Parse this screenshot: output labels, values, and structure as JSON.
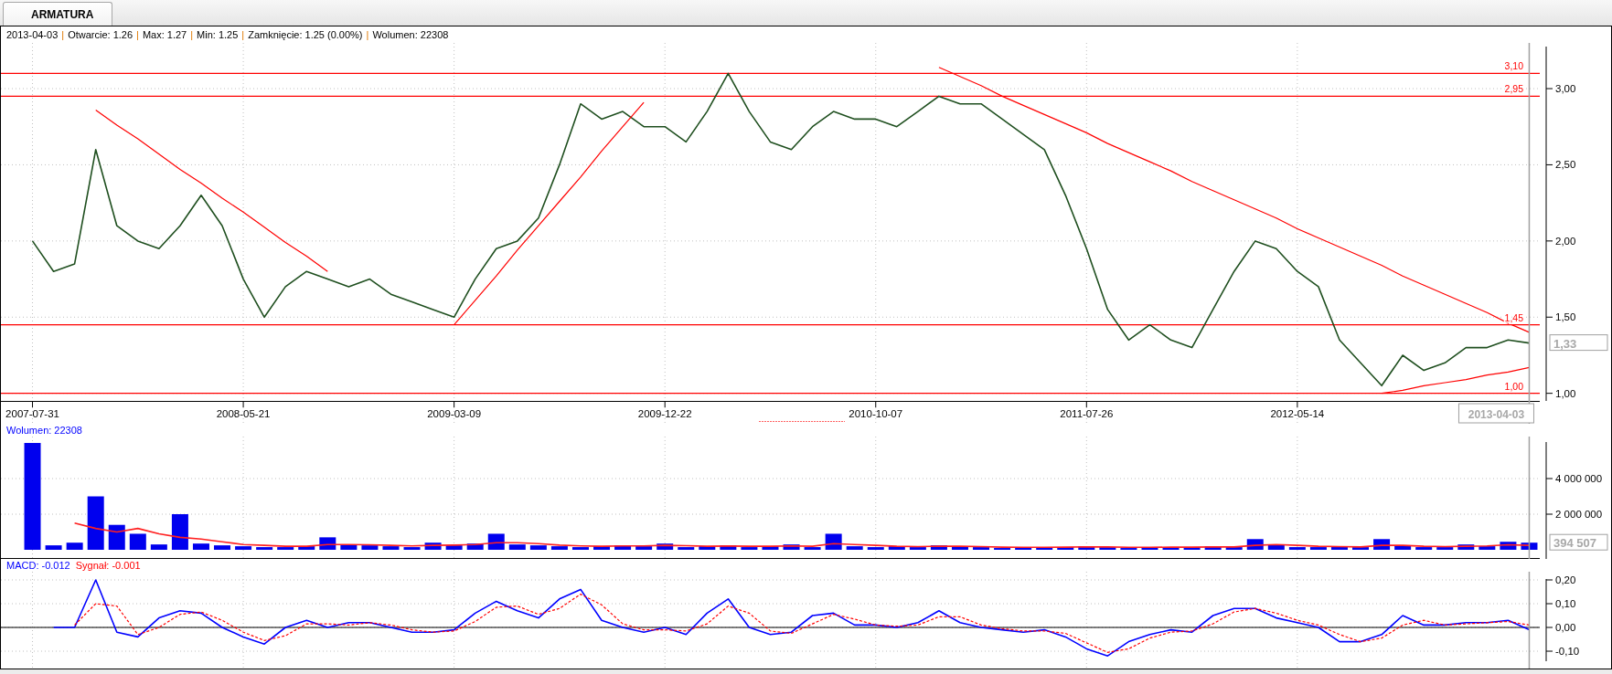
{
  "tabs": [
    {
      "label": "ARMATURA",
      "selected": true
    }
  ],
  "header": [
    {
      "kind": "field",
      "text": "2013-04-03"
    },
    {
      "kind": "separator",
      "text": "|"
    },
    {
      "kind": "field",
      "text": "Otwarcie: 1.26"
    },
    {
      "kind": "separator",
      "text": "|"
    },
    {
      "kind": "field",
      "text": "Max: 1.27"
    },
    {
      "kind": "separator",
      "text": "|"
    },
    {
      "kind": "field",
      "text": "Min: 1.25"
    },
    {
      "kind": "separator",
      "text": "|"
    },
    {
      "kind": "field",
      "text": "Zamknięcie: 1.25 (0.00%)"
    },
    {
      "kind": "separator",
      "text": "|"
    },
    {
      "kind": "field",
      "text": "Wolumen: 22308"
    }
  ],
  "price_panel": {
    "chart_data": {
      "type": "line",
      "grid": true,
      "categories": [
        "2007-07-31",
        null,
        null,
        null,
        null,
        null,
        null,
        null,
        null,
        null,
        "2008-05-21",
        null,
        null,
        null,
        null,
        null,
        null,
        null,
        null,
        null,
        "2009-03-09",
        null,
        null,
        null,
        null,
        null,
        null,
        null,
        null,
        null,
        "2009-12-22",
        null,
        null,
        null,
        null,
        null,
        null,
        null,
        null,
        null,
        "2010-10-07",
        null,
        null,
        null,
        null,
        null,
        null,
        null,
        null,
        null,
        "2011-07-26",
        null,
        null,
        null,
        null,
        null,
        null,
        null,
        null,
        null,
        "2012-05-14",
        null,
        null,
        null,
        null,
        null,
        null,
        null,
        null,
        null,
        null,
        null
      ],
      "ylim": [
        0.95,
        3.3
      ],
      "yticks": [
        {
          "value": 1,
          "label": "1,00"
        },
        {
          "value": 1.5,
          "label": "1,50"
        },
        {
          "value": 2,
          "label": "2,00"
        },
        {
          "value": 2.5,
          "label": "2,50"
        },
        {
          "value": 3,
          "label": "3,00"
        }
      ],
      "series": [
        {
          "color": "#1f4f1f",
          "values": [
            2.0,
            1.8,
            1.85,
            2.6,
            2.1,
            2.0,
            1.95,
            2.1,
            2.3,
            2.1,
            1.75,
            1.5,
            1.7,
            1.8,
            1.75,
            1.7,
            1.75,
            1.65,
            1.6,
            1.55,
            1.5,
            1.75,
            1.95,
            2.0,
            2.15,
            2.5,
            2.9,
            2.8,
            2.85,
            2.75,
            2.75,
            2.65,
            2.85,
            3.1,
            2.85,
            2.65,
            2.6,
            2.75,
            2.85,
            2.8,
            2.8,
            2.75,
            2.85,
            2.95,
            2.9,
            2.9,
            2.8,
            2.7,
            2.6,
            2.3,
            1.95,
            1.55,
            1.35,
            1.45,
            1.35,
            1.3,
            1.55,
            1.8,
            2.0,
            1.95,
            1.8,
            1.7,
            1.35,
            1.2,
            1.05,
            1.25,
            1.15,
            1.2,
            1.3,
            1.3,
            1.35,
            1.33
          ]
        },
        {
          "color": "#ff0000",
          "values": [
            null,
            null,
            null,
            2.86,
            2.76,
            2.67,
            2.57,
            2.47,
            2.38,
            2.28,
            2.19,
            2.09,
            1.99,
            1.9,
            1.8,
            null,
            null,
            null,
            null,
            null,
            null,
            null,
            null,
            null,
            null,
            null,
            null,
            null,
            null,
            null,
            null,
            null,
            null,
            null,
            null,
            null,
            null,
            null,
            null,
            null,
            null,
            null,
            null,
            null,
            null,
            null,
            null,
            null,
            null,
            null,
            null,
            null,
            null,
            null,
            null,
            null,
            null,
            null,
            null,
            null,
            null,
            null,
            null,
            null,
            null,
            null,
            null,
            null,
            null,
            null,
            null,
            null
          ]
        },
        {
          "color": "#ff0000",
          "values": [
            null,
            null,
            null,
            null,
            null,
            null,
            null,
            null,
            null,
            null,
            null,
            null,
            null,
            null,
            null,
            null,
            null,
            null,
            null,
            null,
            1.45,
            1.61,
            1.77,
            1.94,
            2.1,
            2.26,
            2.42,
            2.59,
            2.75,
            2.91,
            null,
            null,
            null,
            null,
            null,
            null,
            null,
            null,
            null,
            null,
            null,
            null,
            null,
            null,
            null,
            null,
            null,
            null,
            null,
            null,
            null,
            null,
            null,
            null,
            null,
            null,
            null,
            null,
            null,
            null,
            null,
            null,
            null,
            null,
            null,
            null,
            null,
            null,
            null,
            null,
            null,
            null
          ]
        },
        {
          "color": "#ff0000",
          "values": [
            null,
            null,
            null,
            null,
            null,
            null,
            null,
            null,
            null,
            null,
            null,
            null,
            null,
            null,
            null,
            null,
            null,
            null,
            null,
            null,
            null,
            null,
            null,
            null,
            null,
            null,
            null,
            null,
            null,
            null,
            null,
            null,
            null,
            null,
            null,
            null,
            null,
            null,
            null,
            null,
            null,
            null,
            null,
            3.14,
            3.08,
            3.02,
            2.95,
            2.89,
            2.83,
            2.77,
            2.71,
            2.64,
            2.58,
            2.52,
            2.46,
            2.39,
            2.33,
            2.27,
            2.21,
            2.15,
            2.08,
            2.02,
            1.96,
            1.9,
            1.84,
            1.77,
            1.71,
            1.65,
            1.59,
            1.53,
            1.46,
            1.4
          ]
        },
        {
          "color": "#ff0000",
          "values": [
            null,
            null,
            null,
            null,
            null,
            null,
            null,
            null,
            null,
            null,
            null,
            null,
            null,
            null,
            null,
            null,
            null,
            null,
            null,
            null,
            null,
            null,
            null,
            null,
            null,
            null,
            null,
            null,
            null,
            null,
            null,
            null,
            null,
            null,
            null,
            null,
            null,
            null,
            null,
            null,
            null,
            null,
            null,
            null,
            null,
            null,
            null,
            null,
            null,
            null,
            null,
            null,
            null,
            null,
            null,
            null,
            null,
            null,
            null,
            null,
            null,
            null,
            null,
            null,
            1.0,
            1.02,
            1.05,
            1.07,
            1.09,
            1.12,
            1.14,
            1.17
          ]
        }
      ],
      "ref_lines": [
        {
          "axis": "y",
          "value": 3.1,
          "label": "3,10",
          "color": "#ff0000"
        },
        {
          "axis": "y",
          "value": 2.95,
          "label": "2,95",
          "color": "#ff0000"
        },
        {
          "axis": "y",
          "value": 1.45,
          "label": "1,45",
          "color": "#ff0000"
        },
        {
          "axis": "y",
          "value": 1.0,
          "label": "1,00",
          "color": "#ff0000"
        }
      ],
      "annotations": [
        "1,33"
      ]
    },
    "date_marker": "2013-04-03"
  },
  "volume_panel": {
    "label": "Wolumen: 22308",
    "chart_data": {
      "type": "bar",
      "grid": true,
      "ylim": [
        0,
        6360000
      ],
      "yticks": [
        {
          "value": 2000000,
          "label": "2 000 000"
        },
        {
          "value": 4000000,
          "label": "4 000 000"
        }
      ],
      "series": [
        {
          "color": "#0000ee",
          "values": [
            6000000,
            250000,
            400000,
            3000000,
            1400000,
            900000,
            300000,
            2000000,
            350000,
            250000,
            200000,
            150000,
            150000,
            200000,
            700000,
            300000,
            250000,
            200000,
            150000,
            400000,
            250000,
            350000,
            900000,
            300000,
            250000,
            200000,
            150000,
            200000,
            250000,
            200000,
            350000,
            150000,
            200000,
            250000,
            150000,
            200000,
            300000,
            150000,
            900000,
            200000,
            150000,
            200000,
            150000,
            250000,
            200000,
            150000,
            100000,
            150000,
            150000,
            150000,
            200000,
            150000,
            100000,
            150000,
            150000,
            150000,
            200000,
            150000,
            600000,
            300000,
            150000,
            150000,
            200000,
            150000,
            600000,
            250000,
            150000,
            150000,
            300000,
            200000,
            450000,
            400000
          ]
        },
        {
          "type": "line",
          "color": "#ff2020",
          "values": [
            null,
            null,
            1500000,
            1200000,
            1000000,
            1200000,
            900000,
            700000,
            600000,
            450000,
            300000,
            250000,
            200000,
            200000,
            300000,
            300000,
            280000,
            250000,
            220000,
            250000,
            260000,
            300000,
            400000,
            400000,
            350000,
            260000,
            220000,
            200000,
            220000,
            220000,
            250000,
            230000,
            200000,
            210000,
            200000,
            200000,
            220000,
            200000,
            350000,
            300000,
            250000,
            200000,
            180000,
            200000,
            200000,
            180000,
            150000,
            140000,
            140000,
            150000,
            170000,
            160000,
            140000,
            140000,
            150000,
            150000,
            160000,
            160000,
            250000,
            300000,
            250000,
            200000,
            180000,
            160000,
            250000,
            250000,
            200000,
            180000,
            200000,
            220000,
            280000,
            250000
          ]
        }
      ],
      "annotations": [
        "394 507"
      ]
    }
  },
  "macd_panel": {
    "labels": [
      {
        "text": "MACD: -0.012",
        "color": "#0000ff"
      },
      {
        "text": "Sygnał: -0.001",
        "color": "#ff0000"
      }
    ],
    "chart_data": {
      "type": "line",
      "grid": true,
      "ylim": [
        -0.173,
        0.2346
      ],
      "yticks": [
        {
          "value": 0.2,
          "label": "0,20"
        },
        {
          "value": 0.1,
          "label": "0,10"
        },
        {
          "value": 0,
          "label": "0,00"
        },
        {
          "value": -0.1,
          "label": "-0,10"
        }
      ],
      "series": [
        {
          "color": "#0000ff",
          "values": [
            null,
            0,
            0,
            0.2,
            -0.02,
            -0.04,
            0.04,
            0.07,
            0.06,
            0,
            -0.04,
            -0.07,
            0,
            0.03,
            0,
            0.02,
            0.02,
            0,
            -0.02,
            -0.02,
            -0.01,
            0.06,
            0.11,
            0.07,
            0.04,
            0.12,
            0.16,
            0.03,
            0,
            -0.02,
            0,
            -0.03,
            0.06,
            0.12,
            0,
            -0.03,
            -0.02,
            0.05,
            0.06,
            0.01,
            0.01,
            0,
            0.02,
            0.07,
            0.02,
            0,
            -0.01,
            -0.02,
            -0.01,
            -0.04,
            -0.09,
            -0.12,
            -0.06,
            -0.03,
            -0.01,
            -0.02,
            0.05,
            0.08,
            0.08,
            0.04,
            0.02,
            0,
            -0.06,
            -0.06,
            -0.03,
            0.05,
            0.01,
            0.01,
            0.02,
            0.02,
            0.03,
            -0.01
          ]
        },
        {
          "color": "#ff0000",
          "line_style": "dashed",
          "values": [
            null,
            null,
            0.01,
            0.1,
            0.09,
            -0.03,
            0,
            0.055,
            0.065,
            0.03,
            -0.02,
            -0.055,
            -0.035,
            0.015,
            0.015,
            0.01,
            0.02,
            0.01,
            -0.01,
            -0.02,
            -0.015,
            0.025,
            0.085,
            0.09,
            0.055,
            0.08,
            0.14,
            0.095,
            0.015,
            -0.01,
            -0.01,
            -0.015,
            0.015,
            0.09,
            0.06,
            -0.015,
            -0.025,
            0.015,
            0.055,
            0.035,
            0.01,
            0.005,
            0.01,
            0.045,
            0.045,
            0.01,
            -0.005,
            -0.015,
            -0.015,
            -0.025,
            -0.065,
            -0.105,
            -0.09,
            -0.045,
            -0.02,
            -0.015,
            0.015,
            0.065,
            0.08,
            0.06,
            0.03,
            0.01,
            -0.03,
            -0.06,
            -0.045,
            0.01,
            0.03,
            0.01,
            0.015,
            0.02,
            0.025,
            0.01
          ]
        }
      ]
    }
  }
}
